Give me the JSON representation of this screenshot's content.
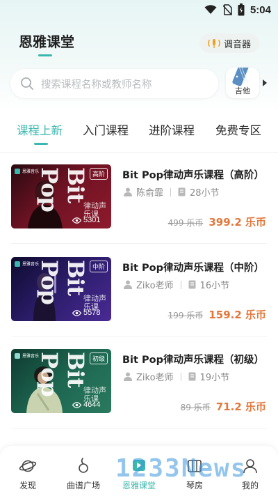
{
  "status_bar": {
    "time": "5:04"
  },
  "header": {
    "title": "恩雅课堂",
    "tuner_label": "调音器"
  },
  "search": {
    "placeholder": "搜索课程名称或教师名称"
  },
  "instrument": {
    "label": "吉他"
  },
  "tabs": [
    {
      "label": "课程上新",
      "active": true
    },
    {
      "label": "入门课程",
      "active": false
    },
    {
      "label": "进阶课程",
      "active": false
    },
    {
      "label": "免费专区",
      "active": false
    }
  ],
  "courses": [
    {
      "title": "Bit Pop律动声乐课程（高阶）",
      "teacher": "陈俞霏",
      "lessons": "28小节",
      "price_old": "499 乐币",
      "price_new": "399.2 乐币",
      "thumb": {
        "logo": "恩雅音乐",
        "big_text": "Bit Pop",
        "sub_text": "律动声乐课",
        "level": "高阶",
        "views": "5301"
      }
    },
    {
      "title": "Bit Pop律动声乐课程（中阶）",
      "teacher": "Ziko老师",
      "lessons": "16小节",
      "price_old": "199 乐币",
      "price_new": "159.2 乐币",
      "thumb": {
        "logo": "恩雅音乐",
        "big_text": "Bit Pop",
        "sub_text": "律动声乐课",
        "level": "中阶",
        "views": "5578"
      }
    },
    {
      "title": "Bit Pop律动声乐课程（初级）",
      "teacher": "Ziko老师",
      "lessons": "19小节",
      "price_old": "89 乐币",
      "price_new": "71.2 乐币",
      "thumb": {
        "logo": "恩雅音乐",
        "big_text": "Bit Pop",
        "sub_text": "律动声乐课",
        "level": "初级",
        "views": "4644"
      }
    }
  ],
  "bottom_nav": [
    {
      "label": "发现",
      "icon": "planet-icon",
      "active": false
    },
    {
      "label": "曲谱广场",
      "icon": "note-icon",
      "active": false
    },
    {
      "label": "恩雅课堂",
      "icon": "classroom-icon",
      "active": true
    },
    {
      "label": "琴房",
      "icon": "piano-room-icon",
      "active": false
    },
    {
      "label": "我的",
      "icon": "profile-icon",
      "active": false
    }
  ],
  "watermark": "1233News",
  "colors": {
    "accent": "#3bb8ae",
    "price": "#e2773b"
  }
}
